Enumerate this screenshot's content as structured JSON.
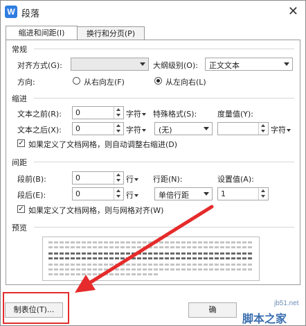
{
  "window": {
    "title": "段落",
    "app_icon_letter": "W",
    "close_glyph": "✕"
  },
  "tabs": [
    {
      "label": "缩进和间距(I)",
      "active": true
    },
    {
      "label": "换行和分页(P)",
      "active": false
    }
  ],
  "general": {
    "section": "常规",
    "alignment_label": "对齐方式(G):",
    "alignment_value": "",
    "outline_label": "大纲级别(O):",
    "outline_value": "正文文本",
    "direction_label": "方向:",
    "rtl_label": "从右向左(F)",
    "ltr_label": "从左向右(L)",
    "direction_selected": "ltr"
  },
  "indent": {
    "section": "缩进",
    "before_label": "文本之前(R):",
    "before_value": "0",
    "after_label": "文本之后(X):",
    "after_value": "0",
    "unit": "字符",
    "special_label": "特殊格式(S):",
    "special_value": "(无)",
    "measure_label": "度量值(Y):",
    "measure_value": "",
    "measure_unit": "字符",
    "grid_check_label": "如果定义了文档网格，则自动调整右缩进(D)",
    "grid_checked": true
  },
  "spacing": {
    "section": "间距",
    "before_label": "段前(B):",
    "before_value": "0",
    "after_label": "段后(E):",
    "after_value": "0",
    "unit": "行",
    "line_label": "行距(N):",
    "line_value": "单倍行距",
    "setting_label": "设置值(A):",
    "setting_value": "1",
    "grid_check_label": "如果定义了文档网格，则与网格对齐(W)",
    "grid_checked": true
  },
  "preview": {
    "section": "预览"
  },
  "footer": {
    "tabs_button": "制表位(T)...",
    "ok_button": "确"
  },
  "annotation": {
    "highlight_color": "#e52b2b"
  },
  "watermark": {
    "line1": "jb51.net",
    "line2": "脚本之家"
  }
}
